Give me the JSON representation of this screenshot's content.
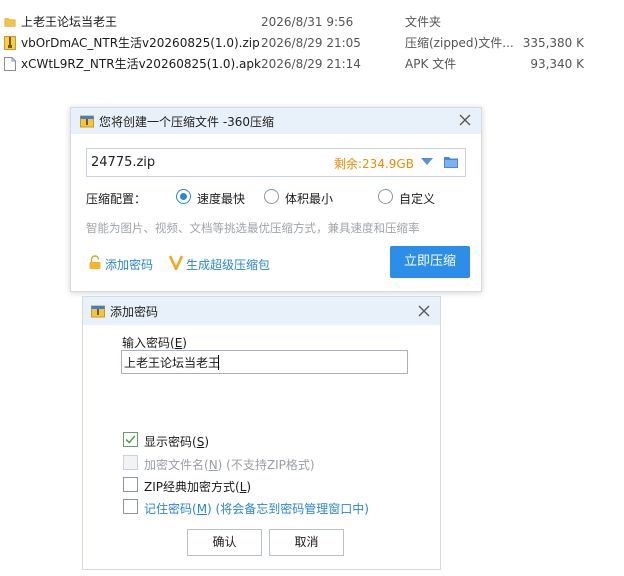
{
  "files": [
    {
      "name": "上老王论坛当老王",
      "date": "2026/8/31 9:56",
      "type": "文件夹",
      "size": "",
      "icon": "folder-icon"
    },
    {
      "name": "vbOrDmAC_NTR生活v20260825(1.0).zip",
      "date": "2026/8/29 21:05",
      "type": "压缩(zipped)文件...",
      "size": "335,380 K",
      "icon": "zip-file-icon"
    },
    {
      "name": "xCWtL9RZ_NTR生活v20260825(1.0).apk",
      "date": "2026/8/29 21:14",
      "type": "APK 文件",
      "size": "93,340 K",
      "icon": "apk-file-icon"
    }
  ],
  "compress_dialog": {
    "title": "您将创建一个压缩文件 -360压缩",
    "file_name": "24775.zip",
    "free_space": "剩余:234.9GB",
    "config_label": "压缩配置：",
    "options": [
      {
        "label": "速度最快",
        "selected": true
      },
      {
        "label": "体积最小",
        "selected": false
      },
      {
        "label": "自定义",
        "selected": false
      }
    ],
    "hint": "智能为图片、视频、文档等挑选最优压缩方式，兼具速度和压缩率",
    "add_password_link": "添加密码",
    "super_pack_link": "生成超级压缩包",
    "compress_button": "立即压缩"
  },
  "password_dialog": {
    "title": "添加密码",
    "input_label": "输入密码(",
    "input_label_key": "E",
    "input_label_end": ")",
    "password_value": "上老王论坛当老王",
    "show_password": {
      "pre": "显示密码(",
      "key": "S",
      "post": ")",
      "checked": true
    },
    "encrypt_names": {
      "pre": "加密文件名(",
      "key": "N",
      "post": ") (不支持ZIP格式)",
      "checked": false,
      "disabled": true
    },
    "zip_classic": {
      "pre": "ZIP经典加密方式(",
      "key": "L",
      "post": ")",
      "checked": false
    },
    "remember": {
      "pre": "记住密码(",
      "key": "M",
      "post": ") (将会备忘到密码管理窗口中)",
      "checked": false
    },
    "ok_button": "确认",
    "cancel_button": "取消"
  },
  "colors": {
    "accent": "#2a86d6",
    "button_blue": "#2c8ee8",
    "free_space": "#f08c00",
    "title_bar": "#e8f0f9"
  }
}
